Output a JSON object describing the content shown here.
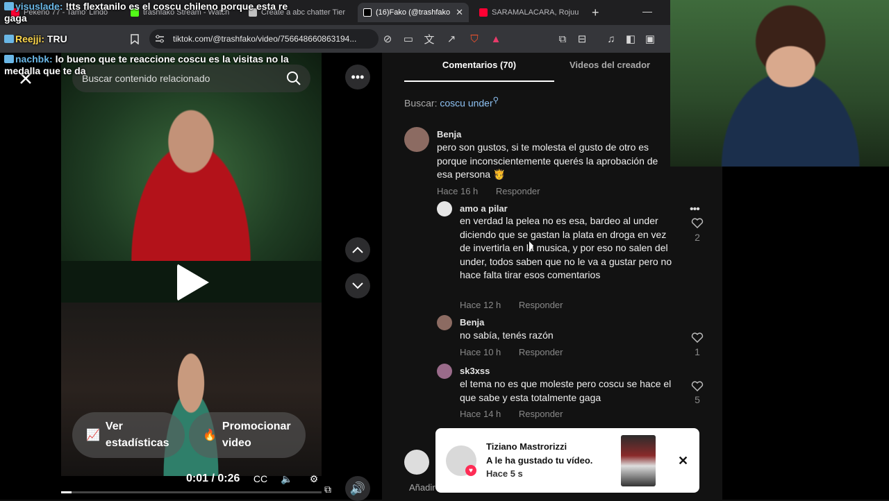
{
  "browser": {
    "tabs": [
      {
        "label": "Pekeño 77 - Tamo' Lindo",
        "active": false,
        "color": "#ff0033"
      },
      {
        "label": "trashfako Stream - Watch",
        "active": false,
        "color": "#53fc18"
      },
      {
        "label": "Create a abc chatter Tier",
        "active": false,
        "color": "#c0c0c0"
      },
      {
        "label": "(16)Fako (@trashfako",
        "active": true,
        "color": "#ffffff"
      },
      {
        "label": "SARAMALACARA, Rojuu",
        "active": false,
        "color": "#ff0033"
      }
    ],
    "new_tab": "+",
    "minimize": "—",
    "url": "tiktok.com/@trashfako/video/756648660863194..."
  },
  "chat": [
    {
      "user": "yisuslade:",
      "message": "!tts flextanilo es el coscu chileno porque esta re gaga",
      "user_color": "#6ab7e6"
    },
    {
      "user": "Reejji:",
      "message": "TRU",
      "user_color": "#ffd84d"
    },
    {
      "user": "nachbk:",
      "message": "lo bueno que te reaccione coscu es la visitas no la medalla que te da",
      "user_color": "#6ab7e6"
    }
  ],
  "video": {
    "search_placeholder": "Buscar contenido relacionado",
    "stats_button": "Ver estadísticas",
    "promote_button": "Promocionar video",
    "time": "0:01 / 0:26",
    "progress": 0.04
  },
  "comments_panel": {
    "tab_comments": "Comentarios (70)",
    "tab_creator": "Videos del creador",
    "search_label": "Buscar:",
    "search_term": "coscu under",
    "comments": [
      {
        "user": "Benja",
        "text": "pero son gustos, si te molesta el gusto de otro es porque inconscientemente querés la aprobación de esa persona 🫅",
        "time": "Hace 16 h",
        "reply": "Responder"
      },
      {
        "user": "amo a pilar",
        "text": "en verdad la pelea no es esa, bardeo al under diciendo que se gastan la plata en droga en vez de invertirla en la musica, y por eso no salen del under, todos saben que no le va a gustar pero no hace falta tirar esos comentarios",
        "time": "Hace 12 h",
        "reply": "Responder",
        "likes": "2"
      },
      {
        "user": "Benja",
        "text": "no sabía, tenés razón",
        "time": "Hace 10 h",
        "reply": "Responder",
        "likes": "1"
      },
      {
        "user": "sk3xss",
        "text": "el tema no es que moleste pero coscu se hace el que sabe y esta totalmente gaga",
        "time": "Hace 14 h",
        "reply": "Responder",
        "likes": "5"
      }
    ],
    "add_comment": "Añadir"
  },
  "notification": {
    "name": "Tiziano Mastrorizzi",
    "message": "A le ha gustado tu vídeo.",
    "time": "Hace 5 s"
  }
}
